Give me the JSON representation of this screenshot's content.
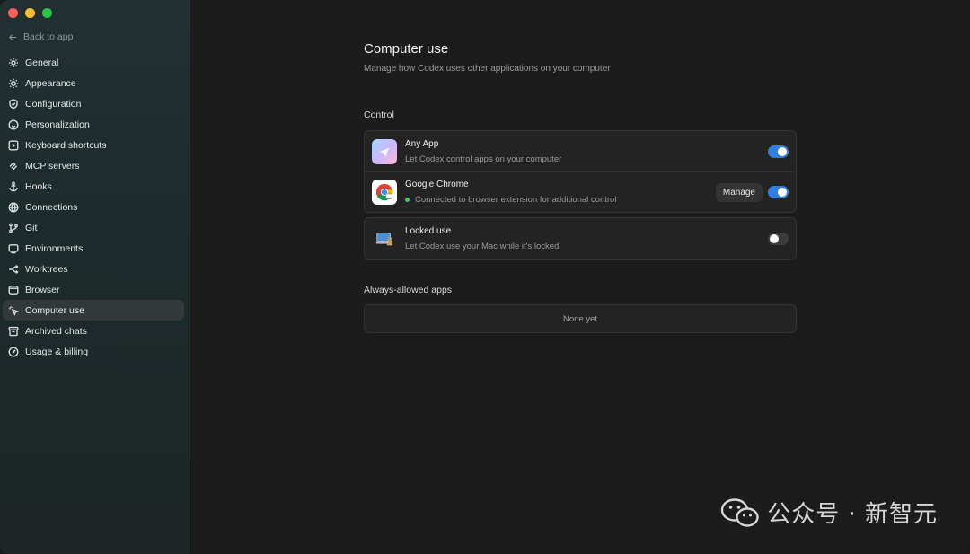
{
  "sidebar": {
    "back_label": "Back to app",
    "items": [
      {
        "label": "General",
        "icon": "gear-icon"
      },
      {
        "label": "Appearance",
        "icon": "sun-icon"
      },
      {
        "label": "Configuration",
        "icon": "shield-icon"
      },
      {
        "label": "Personalization",
        "icon": "smile-icon"
      },
      {
        "label": "Keyboard shortcuts",
        "icon": "keyboard-icon"
      },
      {
        "label": "MCP servers",
        "icon": "mcp-icon"
      },
      {
        "label": "Hooks",
        "icon": "anchor-icon"
      },
      {
        "label": "Connections",
        "icon": "globe-icon"
      },
      {
        "label": "Git",
        "icon": "git-branch-icon"
      },
      {
        "label": "Environments",
        "icon": "monitor-icon"
      },
      {
        "label": "Worktrees",
        "icon": "worktree-icon"
      },
      {
        "label": "Browser",
        "icon": "browser-icon"
      },
      {
        "label": "Computer use",
        "icon": "cursor-icon",
        "active": true
      },
      {
        "label": "Archived chats",
        "icon": "archive-icon"
      },
      {
        "label": "Usage & billing",
        "icon": "gauge-icon"
      }
    ]
  },
  "page": {
    "title": "Computer use",
    "subtitle": "Manage how Codex uses other applications on your computer"
  },
  "control": {
    "label": "Control",
    "any_app": {
      "name": "Any App",
      "desc": "Let Codex control apps on your computer",
      "enabled": true
    },
    "chrome": {
      "name": "Google Chrome",
      "desc": "Connected to browser extension for additional control",
      "manage_label": "Manage",
      "enabled": true
    },
    "locked": {
      "name": "Locked use",
      "desc": "Let Codex use your Mac while it's locked",
      "enabled": false
    }
  },
  "always_allowed": {
    "label": "Always-allowed apps",
    "empty_text": "None yet"
  },
  "watermark": {
    "text": "公众号 · 新智元"
  },
  "colors": {
    "accent": "#2f7fe0",
    "status_green": "#3ad065"
  }
}
